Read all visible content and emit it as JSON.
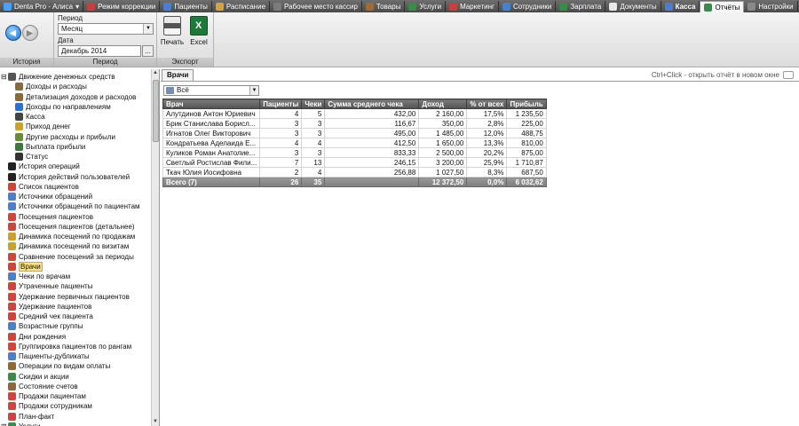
{
  "app_tabs": [
    {
      "label": "Denta Pro - Алиса",
      "icon": "app-logo-icon",
      "color": "#4aa0ff",
      "dropdown": true
    },
    {
      "label": "Режим коррекции",
      "icon": "correction-icon",
      "color": "#c54040"
    },
    {
      "label": "Пациенты",
      "icon": "patients-icon",
      "color": "#4a7fd0"
    },
    {
      "label": "Расписание",
      "icon": "schedule-icon",
      "color": "#d8a23a"
    },
    {
      "label": "Рабочее место кассир",
      "icon": "cashier-icon",
      "color": "#7b7b7b"
    },
    {
      "label": "Товары",
      "icon": "goods-icon",
      "color": "#9b6b3a"
    },
    {
      "label": "Услуги",
      "icon": "services-icon",
      "color": "#3a8a4a"
    },
    {
      "label": "Маркетинг",
      "icon": "marketing-icon",
      "color": "#c54040"
    },
    {
      "label": "Сотрудники",
      "icon": "staff-icon",
      "color": "#4a7fd0"
    },
    {
      "label": "Зарплата",
      "icon": "salary-icon",
      "color": "#3a8a4a"
    },
    {
      "label": "Документы",
      "icon": "documents-icon",
      "color": "#e8e8e8"
    },
    {
      "label": "Касса",
      "icon": "cash-icon",
      "color": "#4a7fd0",
      "bold": true
    },
    {
      "label": "Отчёты",
      "icon": "reports-icon",
      "color": "#3a8a4a",
      "active": true
    },
    {
      "label": "Настройки",
      "icon": "settings-icon",
      "color": "#888888"
    }
  ],
  "ribbon": {
    "history_group": "История",
    "period_group": "Период",
    "export_group": "Экспорт",
    "period_label": "Период",
    "period_value": "Месяц",
    "date_label": "Дата",
    "date_value": "Декабрь 2014",
    "date_button": "...",
    "print_label": "Печать",
    "excel_label": "Excel"
  },
  "tree": {
    "items": [
      {
        "label": "Движение денежных средств",
        "icon": "sigma-icon",
        "color": "#555555",
        "level": 0,
        "expander": "⊟"
      },
      {
        "label": "Доходы и расходы",
        "icon": "income-expense-icon",
        "color": "#8b6a3a",
        "level": 1
      },
      {
        "label": "Детализация доходов и расходов",
        "icon": "detail-icon",
        "color": "#8b6a3a",
        "level": 1
      },
      {
        "label": "Доходы по направлениям",
        "icon": "arrow-right-icon",
        "color": "#2f6fd0",
        "level": 1
      },
      {
        "label": "Касса",
        "icon": "cash-register-icon",
        "color": "#444444",
        "level": 1
      },
      {
        "label": "Приход денег",
        "icon": "money-in-icon",
        "color": "#c9a227",
        "level": 1
      },
      {
        "label": "Другие расходы и прибыли",
        "icon": "money-other-icon",
        "color": "#6a8a3a",
        "level": 1
      },
      {
        "label": "Выплата прибыли",
        "icon": "payout-icon",
        "color": "#3a7a3a",
        "level": 1
      },
      {
        "label": "Статус",
        "icon": "thermometer-icon",
        "color": "#333333",
        "level": 1
      },
      {
        "label": "История операций",
        "icon": "history-icon",
        "color": "#222222",
        "level": 0
      },
      {
        "label": "История действий пользователей",
        "icon": "user-history-icon",
        "color": "#222222",
        "level": 0
      },
      {
        "label": "Список пациентов",
        "icon": "patient-list-icon",
        "color": "#d0443a",
        "level": 0
      },
      {
        "label": "Источники обращений",
        "icon": "source-icon",
        "color": "#4a7fd0",
        "level": 0
      },
      {
        "label": "Источники обращений по пациентам",
        "icon": "source-patient-icon",
        "color": "#4a7fd0",
        "level": 0
      },
      {
        "label": "Посещения пациентов",
        "icon": "visits-icon",
        "color": "#d0443a",
        "level": 0
      },
      {
        "label": "Посещения пациентов (детальнее)",
        "icon": "visits-detail-icon",
        "color": "#d0443a",
        "level": 0
      },
      {
        "label": "Динамика посещений по продажам",
        "icon": "dynamics-sales-icon",
        "color": "#c9a227",
        "level": 0
      },
      {
        "label": "Динамика посещений по визитам",
        "icon": "dynamics-visits-icon",
        "color": "#c9a227",
        "level": 0
      },
      {
        "label": "Сравнение посещений за периоды",
        "icon": "compare-icon",
        "color": "#d0443a",
        "level": 0
      },
      {
        "label": "Врачи",
        "icon": "doctors-icon",
        "color": "#d0443a",
        "level": 0,
        "selected": true
      },
      {
        "label": "Чеки по врачам",
        "icon": "receipts-icon",
        "color": "#4a7fd0",
        "level": 0
      },
      {
        "label": "Утраченные пациенты",
        "icon": "lost-patients-icon",
        "color": "#d0443a",
        "level": 0
      },
      {
        "label": "Удержание первичных пациентов",
        "icon": "retention-first-icon",
        "color": "#d0443a",
        "level": 0
      },
      {
        "label": "Удержание пациентов",
        "icon": "retention-icon",
        "color": "#d0443a",
        "level": 0
      },
      {
        "label": "Средний чек пациента",
        "icon": "average-check-icon",
        "color": "#d0443a",
        "level": 0
      },
      {
        "label": "Возрастные группы",
        "icon": "age-groups-icon",
        "color": "#4a7fd0",
        "level": 0
      },
      {
        "label": "Дни рождения",
        "icon": "birthday-icon",
        "color": "#d0443a",
        "level": 0
      },
      {
        "label": "Группировка пациентов по рангам",
        "icon": "ranks-icon",
        "color": "#d0443a",
        "level": 0
      },
      {
        "label": "Пациенты-дубликаты",
        "icon": "duplicates-icon",
        "color": "#4a7fd0",
        "level": 0
      },
      {
        "label": "Операции по видам оплаты",
        "icon": "payment-types-icon",
        "color": "#8b6a3a",
        "level": 0
      },
      {
        "label": "Скидки и акции",
        "icon": "discounts-icon",
        "color": "#3a8a4a",
        "level": 0
      },
      {
        "label": "Состояние счетов",
        "icon": "accounts-icon",
        "color": "#8b6a3a",
        "level": 0
      },
      {
        "label": "Продажи пациентам",
        "icon": "sales-patients-icon",
        "color": "#d0443a",
        "level": 0
      },
      {
        "label": "Продажи сотрудникам",
        "icon": "sales-staff-icon",
        "color": "#d0443a",
        "level": 0
      },
      {
        "label": "План-факт",
        "icon": "plan-fact-icon",
        "color": "#d0443a",
        "level": 0
      },
      {
        "label": "Услуги",
        "icon": "services-report-icon",
        "color": "#3a8a4a",
        "level": 0,
        "expander": "⊞"
      }
    ]
  },
  "content": {
    "tab": "Врачи",
    "hint": "Ctrl+Click - открыть отчёт в новом окне",
    "filter_value": "Всё",
    "columns": [
      "Врач",
      "Пациенты",
      "Чеки",
      "Сумма среднего чека",
      "Доход",
      "% от всех",
      "Прибыль"
    ],
    "rows": [
      [
        "Алутдинов Антон Юриевич",
        "4",
        "5",
        "432,00",
        "2 160,00",
        "17,5%",
        "1 235,50"
      ],
      [
        "Брик Станислава Борисл...",
        "3",
        "3",
        "116,67",
        "350,00",
        "2,8%",
        "225,00"
      ],
      [
        "Игнатов Олег Викторович",
        "3",
        "3",
        "495,00",
        "1 485,00",
        "12,0%",
        "488,75"
      ],
      [
        "Кондратьева Аделаида Е...",
        "4",
        "4",
        "412,50",
        "1 650,00",
        "13,3%",
        "810,00"
      ],
      [
        "Куликов Роман Анатолие...",
        "3",
        "3",
        "833,33",
        "2 500,00",
        "20,2%",
        "875,00"
      ],
      [
        "Светлый Ростислав Фили...",
        "7",
        "13",
        "246,15",
        "3 200,00",
        "25,9%",
        "1 710,87"
      ],
      [
        "Ткач Юлия Иосифовна",
        "2",
        "4",
        "256,88",
        "1 027,50",
        "8,3%",
        "687,50"
      ]
    ],
    "total": [
      "Всего (7)",
      "26",
      "35",
      "",
      "12 372,50",
      "0,0%",
      "6 032,62"
    ]
  }
}
